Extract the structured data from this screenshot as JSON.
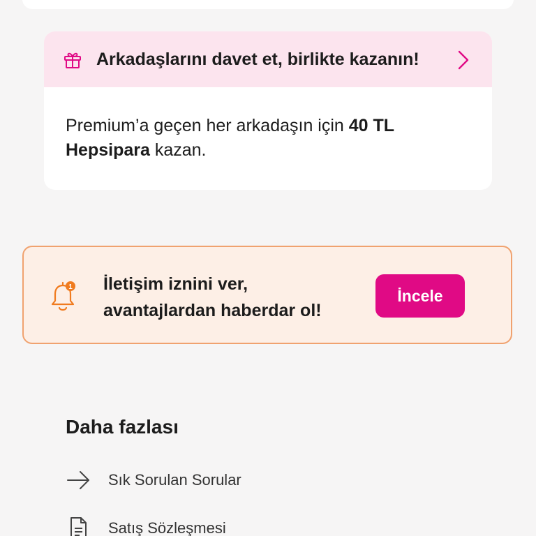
{
  "invite": {
    "title": "Arkadaşlarını davet et, birlikte kazanın!",
    "body_prefix": "Premium’a geçen her arkadaşın için ",
    "body_bold": "40 TL Hepsipara",
    "body_suffix": " kazan.",
    "icon": "gift-icon",
    "accent": "#e00a85",
    "header_bg": "#fce4ee"
  },
  "notification": {
    "line1": "İletişim iznini ver,",
    "line2": "avantajlardan haberdar ol!",
    "badge_count": "1",
    "button_label": "İncele",
    "icon": "bell-icon",
    "bg": "#fdefe6",
    "border": "#f0a26f",
    "button_color": "#e00a85"
  },
  "more": {
    "title": "Daha fazlası",
    "items": [
      {
        "label": "Sık Sorulan Sorular",
        "icon": "arrow-right-icon"
      },
      {
        "label": "Satış Sözleşmesi",
        "icon": "document-icon"
      }
    ]
  }
}
